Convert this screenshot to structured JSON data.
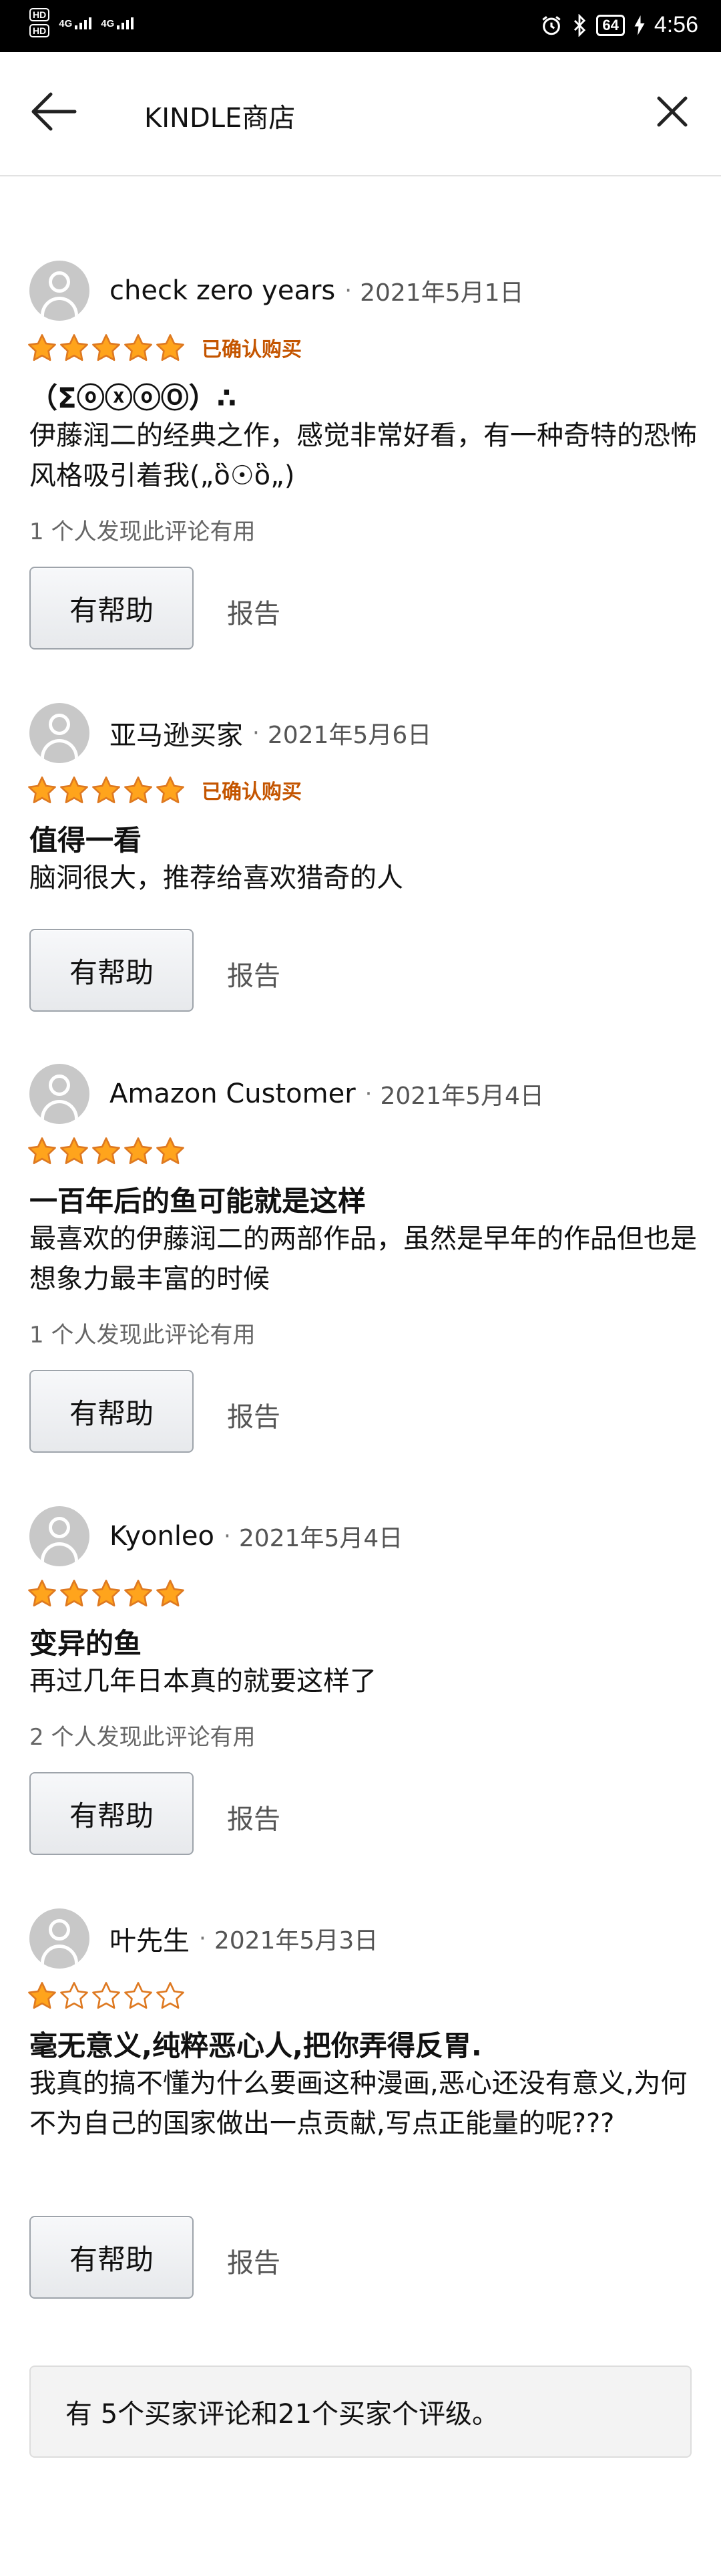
{
  "status_bar": {
    "hd1": "HD",
    "hd2": "HD",
    "net1": "4G",
    "net2": "4G",
    "battery": "64",
    "time": "4:56"
  },
  "header": {
    "title": "KINDLE商店",
    "back_icon": "arrow-left-icon",
    "close_icon": "close-icon"
  },
  "reviews": [
    {
      "reviewer": "check zero years",
      "date": "2021年5月1日",
      "rating": 5,
      "verified": "已确认购买",
      "title": "（ΣⓞⓧⓞⓄ）∴",
      "body": "伊藤润二的经典之作，感觉非常好看，有一种奇特的恐怖风格吸引着我(„ὃ☉ὃ„)",
      "helpful_count": "1 个人发现此评论有用",
      "helpful_label": "有帮助",
      "report_label": "报告"
    },
    {
      "reviewer": "亚马逊买家",
      "date": "2021年5月6日",
      "rating": 5,
      "verified": "已确认购买",
      "title": "值得一看",
      "body": "脑洞很大，推荐给喜欢猎奇的人",
      "helpful_count": "",
      "helpful_label": "有帮助",
      "report_label": "报告"
    },
    {
      "reviewer": "Amazon Customer",
      "date": "2021年5月4日",
      "rating": 5,
      "verified": "",
      "title": "一百年后的鱼可能就是这样",
      "body": "最喜欢的伊藤润二的两部作品，虽然是早年的作品但也是想象力最丰富的时候",
      "helpful_count": "1 个人发现此评论有用",
      "helpful_label": "有帮助",
      "report_label": "报告"
    },
    {
      "reviewer": "Kyonleo",
      "date": "2021年5月4日",
      "rating": 5,
      "verified": "",
      "title": "变异的鱼",
      "body": "再过几年日本真的就要这样了",
      "helpful_count": "2 个人发现此评论有用",
      "helpful_label": "有帮助",
      "report_label": "报告"
    },
    {
      "reviewer": "叶先生",
      "date": "2021年5月3日",
      "rating": 1,
      "verified": "",
      "title": "毫无意义,纯粹恶心人,把你弄得反胃.",
      "body": "我真的搞不懂为什么要画这种漫画,恶心还没有意义,为何不为自己的国家做出一点贡献,写点正能量的呢???",
      "helpful_count": "",
      "helpful_label": "有帮助",
      "report_label": "报告"
    }
  ],
  "summary": {
    "text": "有 5个买家评论和21个买家个评级。"
  },
  "colors": {
    "star_fill": "#ffa41c",
    "star_stroke": "#de7921",
    "verified": "#c45500",
    "status_bar": "#000000"
  }
}
